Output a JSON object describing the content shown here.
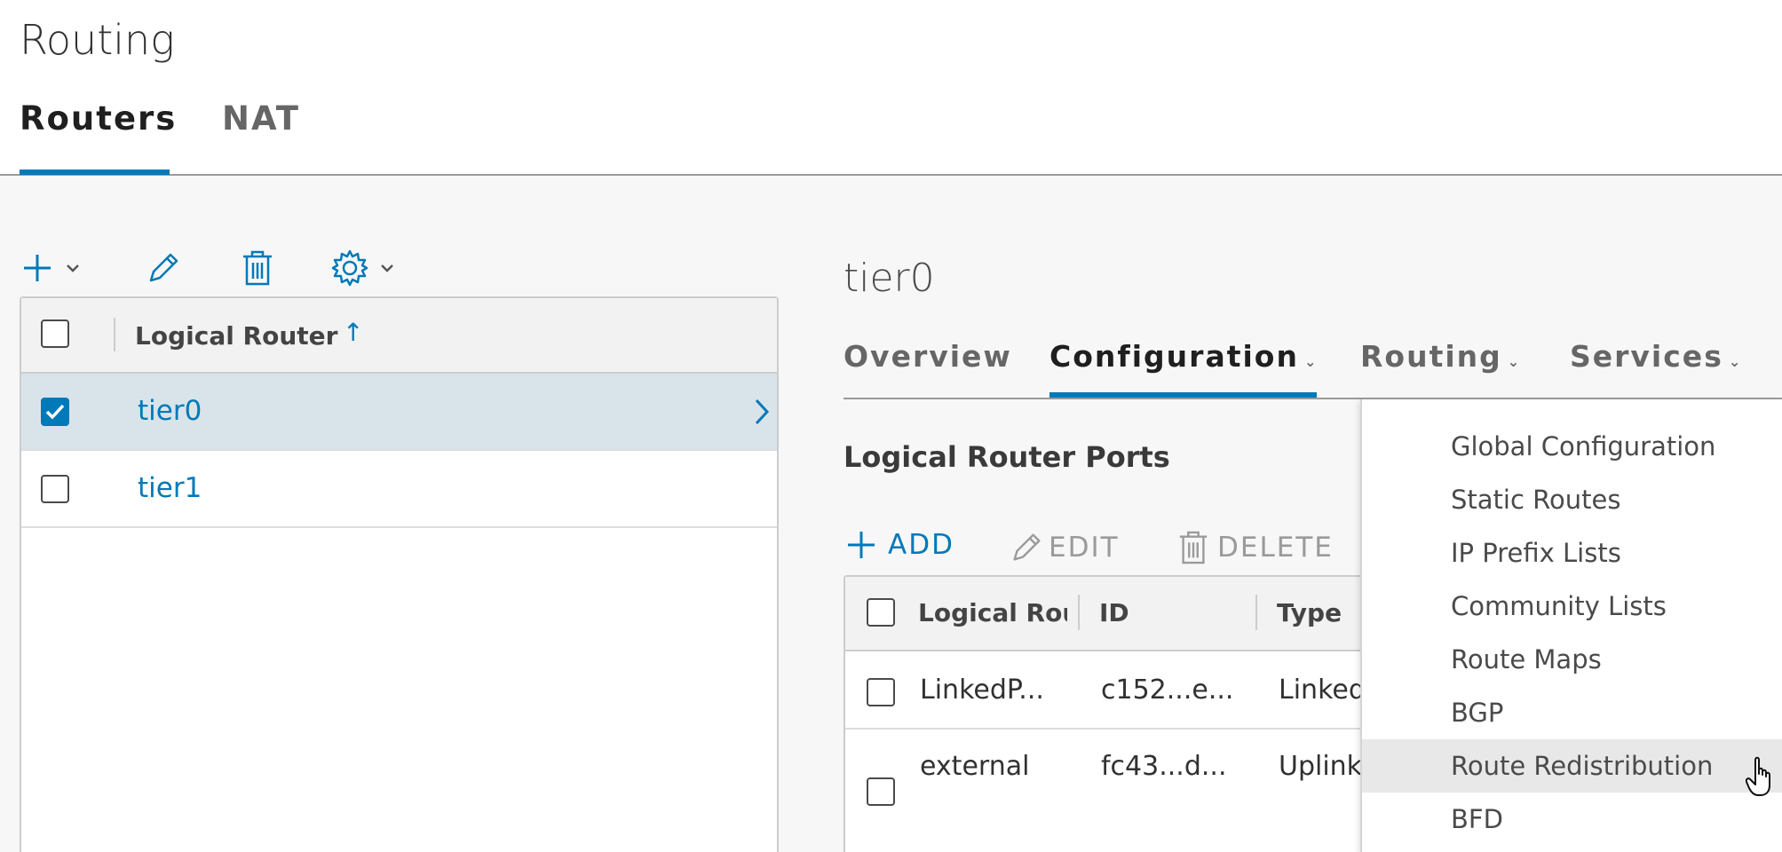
{
  "page": {
    "title": "Routing"
  },
  "main_tabs": [
    {
      "label": "Routers",
      "active": true
    },
    {
      "label": "NAT",
      "active": false
    }
  ],
  "toolbar": {
    "icons": [
      "plus-icon",
      "pencil-icon",
      "trash-icon",
      "gear-icon"
    ]
  },
  "router_grid": {
    "column_header": "Logical Router",
    "sort_indicator": "↑",
    "rows": [
      {
        "name": "tier0",
        "checked": true,
        "selected": true
      },
      {
        "name": "tier1",
        "checked": false,
        "selected": false
      }
    ]
  },
  "detail": {
    "title": "tier0",
    "tabs": [
      {
        "label": "Overview",
        "active": false
      },
      {
        "label": "Configuration",
        "active": true
      },
      {
        "label": "Routing",
        "active": false
      },
      {
        "label": "Services",
        "active": false
      }
    ],
    "section_title": "Logical Router Ports",
    "actions": {
      "add": "ADD",
      "edit": "EDIT",
      "delete": "DELETE"
    },
    "ports_columns": [
      "Logical Rout",
      "ID",
      "Type"
    ],
    "ports_rows": [
      {
        "name": "LinkedP...",
        "id": "c152...e...",
        "type": "Linked"
      },
      {
        "name": "external",
        "id": "fc43...d...",
        "type": "Uplink"
      }
    ]
  },
  "routing_menu": {
    "items": [
      "Global Configuration",
      "Static Routes",
      "IP Prefix Lists",
      "Community Lists",
      "Route Maps",
      "BGP",
      "Route Redistribution",
      "BFD"
    ],
    "hovered": "Route Redistribution"
  },
  "colors": {
    "accent": "#0079b8",
    "selected_row": "#d9e4ea",
    "menu_hover": "#e8e8e8"
  }
}
